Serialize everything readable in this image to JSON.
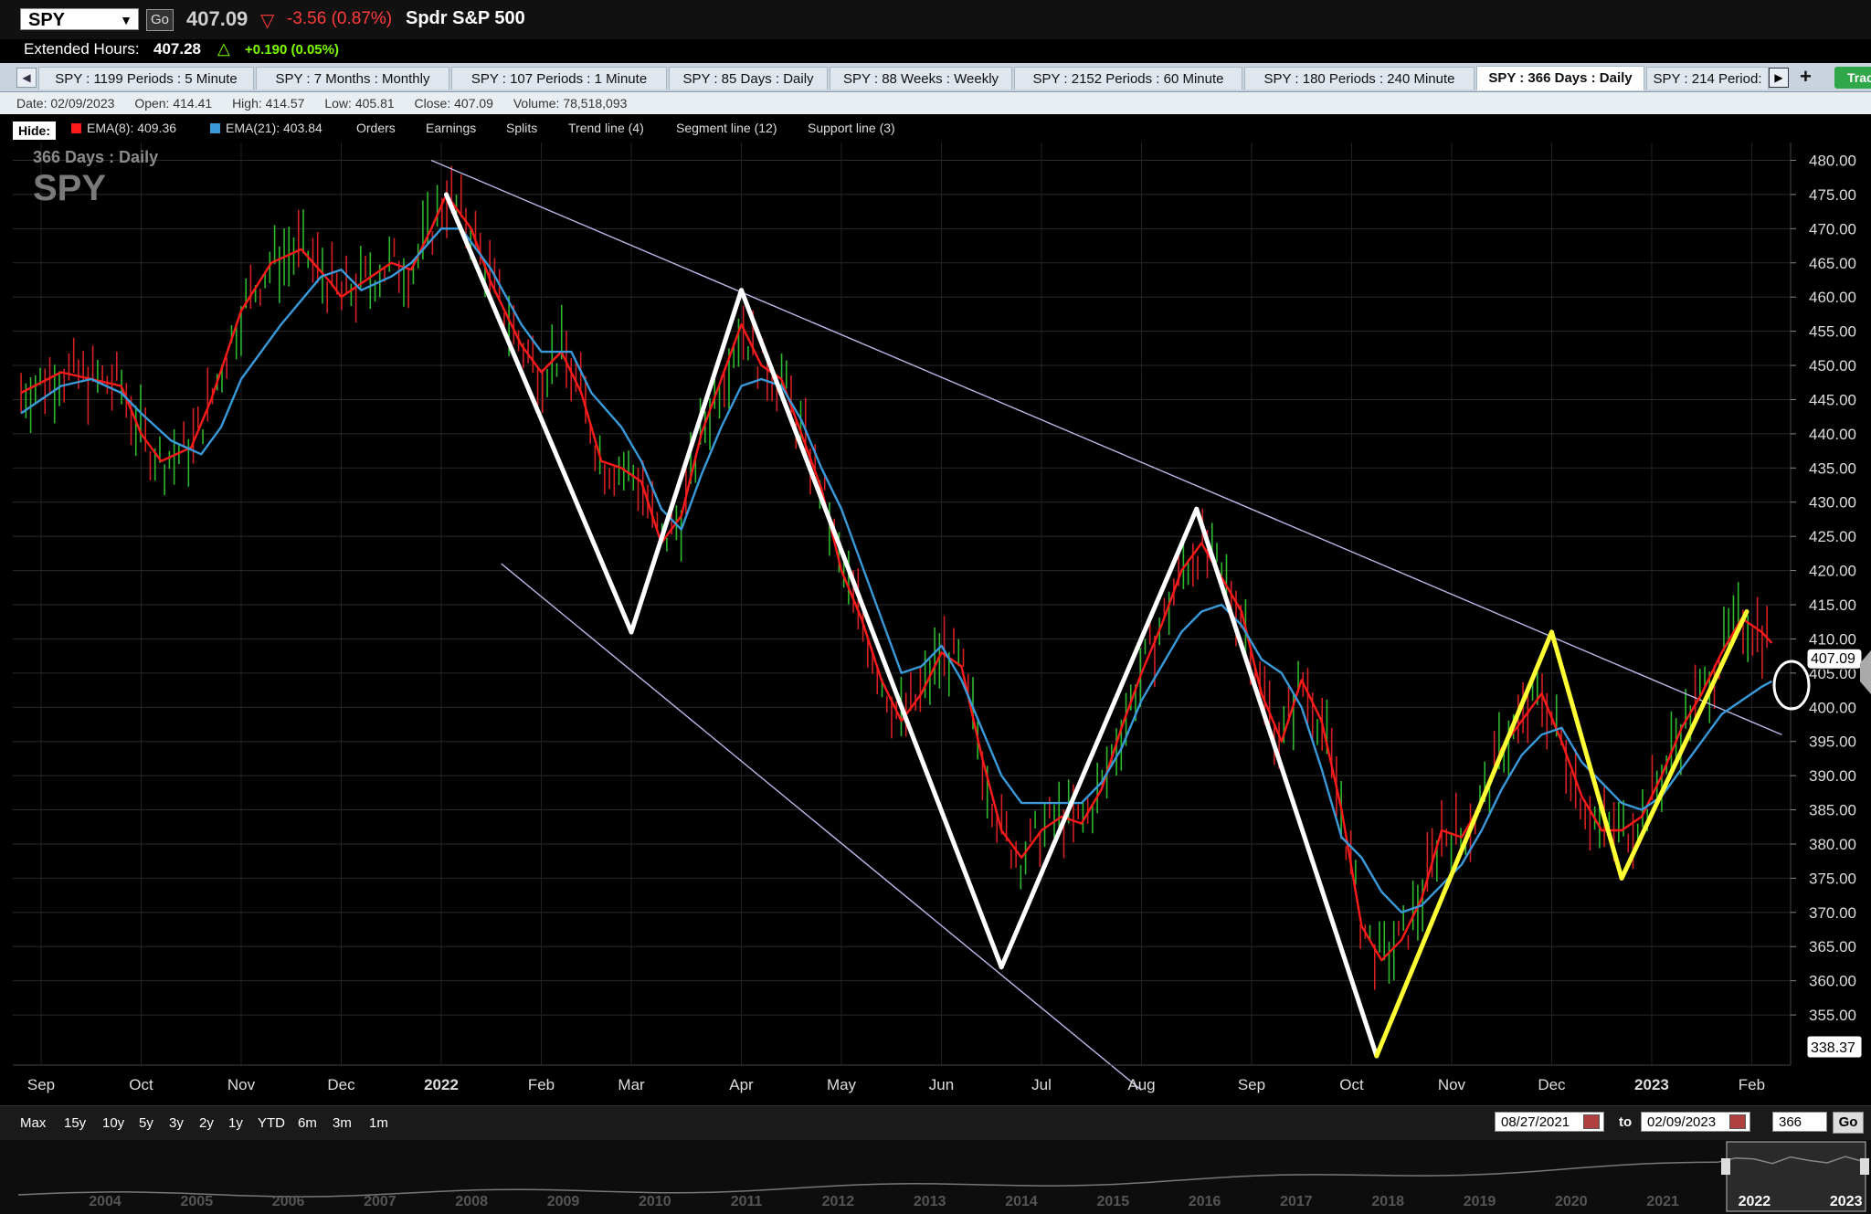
{
  "quote": {
    "symbol": "SPY",
    "go_label": "Go",
    "last": "407.09",
    "change": "-3.56 (0.87%)",
    "company": "Spdr S&P 500"
  },
  "extended": {
    "label": "Extended Hours:",
    "price": "407.28",
    "change": "+0.190 (0.05%)"
  },
  "tabs": [
    {
      "label": "SPY : 1199  Periods : 5 Minute"
    },
    {
      "label": "SPY : 7  Months : Monthly"
    },
    {
      "label": "SPY : 107  Periods : 1 Minute"
    },
    {
      "label": "SPY : 85  Days : Daily"
    },
    {
      "label": "SPY : 88  Weeks : Weekly"
    },
    {
      "label": "SPY : 2152  Periods : 60 Minute"
    },
    {
      "label": "SPY : 180  Periods : 240 Minute"
    },
    {
      "label": "SPY : 366  Days : Daily",
      "active": true
    },
    {
      "label": "SPY : 214  Period:"
    }
  ],
  "trade_label": "Trac",
  "info": {
    "date": "Date: 02/09/2023",
    "open": "Open: 414.41",
    "high": "High: 414.57",
    "low": "Low: 405.81",
    "close": "Close: 407.09",
    "volume": "Volume: 78,518,093"
  },
  "legend": {
    "hide_label": "Hide:",
    "ema8": "EMA(8): 409.36",
    "ema21": "EMA(21): 403.84",
    "orders": "Orders",
    "earnings": "Earnings",
    "splits": "Splits",
    "trend": "Trend line (4)",
    "segment": "Segment line (12)",
    "support": "Support line (3)"
  },
  "colors": {
    "ema8": "#ff1a1a",
    "ema21": "#3a9ad9",
    "up": "#2db82d",
    "down": "#d42020",
    "segment_white": "#ffffff",
    "segment_yellow": "#ffff33",
    "trendline": "#b8b8e8"
  },
  "chart_data": {
    "type": "line",
    "title": "SPY",
    "subtitle": "366  Days : Daily",
    "ylim": [
      349,
      481
    ],
    "y_ticks": [
      480,
      475,
      470,
      465,
      460,
      455,
      450,
      445,
      440,
      435,
      430,
      425,
      420,
      415,
      410,
      405,
      400,
      395,
      390,
      385,
      380,
      375,
      370,
      365,
      360,
      355
    ],
    "y_tick_labels": [
      "480.00",
      "475.00",
      "470.00",
      "465.00",
      "460.00",
      "455.00",
      "450.00",
      "445.00",
      "440.00",
      "435.00",
      "430.00",
      "425.00",
      "420.00",
      "415.00",
      "410.00",
      "405.00",
      "400.00",
      "395.00",
      "390.00",
      "385.00",
      "380.00",
      "375.00",
      "370.00",
      "365.00",
      "360.00",
      "355.00"
    ],
    "x_labels": [
      {
        "t": "Sep",
        "m": 0.0
      },
      {
        "t": "Oct",
        "m": 1.0
      },
      {
        "t": "Nov",
        "m": 2.0
      },
      {
        "t": "Dec",
        "m": 3.0
      },
      {
        "t": "2022",
        "m": 4.0,
        "bold": true
      },
      {
        "t": "Feb",
        "m": 5.0
      },
      {
        "t": "Mar",
        "m": 5.9
      },
      {
        "t": "Apr",
        "m": 7.0
      },
      {
        "t": "May",
        "m": 8.0
      },
      {
        "t": "Jun",
        "m": 9.0
      },
      {
        "t": "Jul",
        "m": 10.0
      },
      {
        "t": "Aug",
        "m": 11.0
      },
      {
        "t": "Sep",
        "m": 12.1
      },
      {
        "t": "Oct",
        "m": 13.1
      },
      {
        "t": "Nov",
        "m": 14.1
      },
      {
        "t": "Dec",
        "m": 15.1
      },
      {
        "t": "2023",
        "m": 16.1,
        "bold": true
      },
      {
        "t": "Feb",
        "m": 17.1
      }
    ],
    "last_price_label": "407.09",
    "last_price": 407.09,
    "low_label": "338.37",
    "series": [
      {
        "name": "EMA(8)",
        "points": [
          [
            -0.2,
            446
          ],
          [
            0.2,
            449
          ],
          [
            0.5,
            448
          ],
          [
            0.8,
            447
          ],
          [
            1.0,
            440
          ],
          [
            1.2,
            436
          ],
          [
            1.5,
            438
          ],
          [
            1.7,
            445
          ],
          [
            2.0,
            458
          ],
          [
            2.3,
            465
          ],
          [
            2.6,
            467
          ],
          [
            2.9,
            462
          ],
          [
            3.0,
            460
          ],
          [
            3.2,
            462
          ],
          [
            3.5,
            465
          ],
          [
            3.7,
            464
          ],
          [
            3.9,
            470
          ],
          [
            4.05,
            475
          ],
          [
            4.3,
            470
          ],
          [
            4.5,
            462
          ],
          [
            4.8,
            453
          ],
          [
            5.0,
            449
          ],
          [
            5.2,
            452
          ],
          [
            5.4,
            446
          ],
          [
            5.6,
            436
          ],
          [
            5.8,
            435
          ],
          [
            6.0,
            433
          ],
          [
            6.2,
            424
          ],
          [
            6.4,
            428
          ],
          [
            6.6,
            440
          ],
          [
            6.8,
            448
          ],
          [
            7.0,
            456
          ],
          [
            7.2,
            450
          ],
          [
            7.4,
            448
          ],
          [
            7.6,
            440
          ],
          [
            7.8,
            432
          ],
          [
            8.0,
            420
          ],
          [
            8.2,
            413
          ],
          [
            8.4,
            404
          ],
          [
            8.6,
            398
          ],
          [
            8.8,
            402
          ],
          [
            9.0,
            408
          ],
          [
            9.2,
            406
          ],
          [
            9.4,
            393
          ],
          [
            9.6,
            382
          ],
          [
            9.8,
            378
          ],
          [
            10.0,
            382
          ],
          [
            10.2,
            384
          ],
          [
            10.4,
            383
          ],
          [
            10.6,
            388
          ],
          [
            10.8,
            397
          ],
          [
            11.0,
            405
          ],
          [
            11.2,
            412
          ],
          [
            11.4,
            420
          ],
          [
            11.6,
            424
          ],
          [
            11.8,
            419
          ],
          [
            12.0,
            414
          ],
          [
            12.2,
            402
          ],
          [
            12.4,
            395
          ],
          [
            12.6,
            404
          ],
          [
            12.8,
            398
          ],
          [
            13.0,
            385
          ],
          [
            13.2,
            368
          ],
          [
            13.4,
            363
          ],
          [
            13.6,
            366
          ],
          [
            13.8,
            372
          ],
          [
            14.0,
            382
          ],
          [
            14.2,
            381
          ],
          [
            14.4,
            386
          ],
          [
            14.6,
            394
          ],
          [
            14.8,
            398
          ],
          [
            15.0,
            402
          ],
          [
            15.2,
            395
          ],
          [
            15.4,
            387
          ],
          [
            15.6,
            382
          ],
          [
            15.8,
            382
          ],
          [
            16.0,
            384
          ],
          [
            16.2,
            390
          ],
          [
            16.4,
            397
          ],
          [
            16.6,
            402
          ],
          [
            16.8,
            408
          ],
          [
            17.0,
            413
          ],
          [
            17.2,
            411
          ],
          [
            17.3,
            409.4
          ]
        ]
      },
      {
        "name": "EMA(21)",
        "points": [
          [
            -0.2,
            443
          ],
          [
            0.2,
            447
          ],
          [
            0.5,
            448
          ],
          [
            0.8,
            446
          ],
          [
            1.0,
            443
          ],
          [
            1.3,
            439
          ],
          [
            1.6,
            437
          ],
          [
            1.8,
            441
          ],
          [
            2.0,
            448
          ],
          [
            2.4,
            456
          ],
          [
            2.8,
            463
          ],
          [
            3.0,
            464
          ],
          [
            3.2,
            461
          ],
          [
            3.5,
            463
          ],
          [
            3.7,
            465
          ],
          [
            4.0,
            470
          ],
          [
            4.2,
            470
          ],
          [
            4.5,
            464
          ],
          [
            4.8,
            456
          ],
          [
            5.0,
            452
          ],
          [
            5.3,
            452
          ],
          [
            5.5,
            446
          ],
          [
            5.8,
            441
          ],
          [
            6.0,
            436
          ],
          [
            6.2,
            429
          ],
          [
            6.4,
            426
          ],
          [
            6.6,
            434
          ],
          [
            6.8,
            441
          ],
          [
            7.0,
            447
          ],
          [
            7.2,
            448
          ],
          [
            7.4,
            447
          ],
          [
            7.6,
            442
          ],
          [
            7.8,
            435
          ],
          [
            8.0,
            429
          ],
          [
            8.2,
            421
          ],
          [
            8.4,
            413
          ],
          [
            8.6,
            405
          ],
          [
            8.8,
            406
          ],
          [
            9.0,
            409
          ],
          [
            9.2,
            404
          ],
          [
            9.4,
            397
          ],
          [
            9.6,
            390
          ],
          [
            9.8,
            386
          ],
          [
            10.0,
            386
          ],
          [
            10.2,
            386
          ],
          [
            10.4,
            386
          ],
          [
            10.6,
            389
          ],
          [
            10.8,
            394
          ],
          [
            11.0,
            401
          ],
          [
            11.2,
            406
          ],
          [
            11.4,
            411
          ],
          [
            11.6,
            414
          ],
          [
            11.8,
            415
          ],
          [
            12.0,
            412
          ],
          [
            12.2,
            407
          ],
          [
            12.4,
            405
          ],
          [
            12.6,
            400
          ],
          [
            12.8,
            391
          ],
          [
            13.0,
            381
          ],
          [
            13.2,
            378
          ],
          [
            13.4,
            373
          ],
          [
            13.6,
            370
          ],
          [
            13.8,
            371
          ],
          [
            14.0,
            374
          ],
          [
            14.2,
            377
          ],
          [
            14.4,
            382
          ],
          [
            14.6,
            388
          ],
          [
            14.8,
            393
          ],
          [
            15.0,
            396
          ],
          [
            15.2,
            397
          ],
          [
            15.4,
            392
          ],
          [
            15.6,
            389
          ],
          [
            15.8,
            386
          ],
          [
            16.0,
            385
          ],
          [
            16.2,
            387
          ],
          [
            16.4,
            391
          ],
          [
            16.6,
            395
          ],
          [
            16.8,
            399
          ],
          [
            17.0,
            401
          ],
          [
            17.2,
            403
          ],
          [
            17.3,
            403.8
          ]
        ]
      }
    ],
    "segment_lines": [
      {
        "color": "white",
        "points": [
          [
            4.05,
            475
          ],
          [
            5.9,
            411
          ],
          [
            7.0,
            461
          ],
          [
            9.6,
            362
          ],
          [
            11.55,
            429
          ],
          [
            13.35,
            349
          ]
        ]
      },
      {
        "color": "yellow",
        "points": [
          [
            13.35,
            349
          ],
          [
            15.1,
            411
          ],
          [
            15.8,
            375
          ],
          [
            17.05,
            414
          ]
        ]
      }
    ],
    "trend_lines": [
      {
        "points": [
          [
            3.9,
            480
          ],
          [
            17.4,
            396
          ]
        ]
      },
      {
        "points": [
          [
            4.6,
            421
          ],
          [
            11.0,
            344
          ]
        ]
      }
    ]
  },
  "bottom": {
    "ranges": [
      "Max",
      "15y",
      "10y",
      "5y",
      "3y",
      "2y",
      "1y",
      "YTD",
      "6m",
      "3m",
      "1m"
    ],
    "from_date": "08/27/2021",
    "to_label": "to",
    "to_date": "02/09/2023",
    "days": "366",
    "go_label": "Go"
  },
  "overview_years": [
    "2004",
    "2005",
    "2006",
    "2007",
    "2008",
    "2009",
    "2010",
    "2011",
    "2012",
    "2013",
    "2014",
    "2015",
    "2016",
    "2017",
    "2018",
    "2019",
    "2020",
    "2021",
    "2022",
    "2023"
  ]
}
